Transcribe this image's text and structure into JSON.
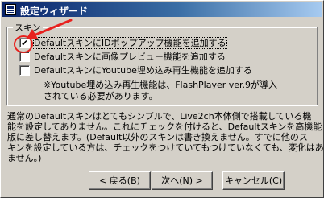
{
  "window": {
    "title": "設定ウィザード"
  },
  "skin_group": {
    "label": "スキン",
    "options": [
      {
        "label": "DefaultスキンにIDポップアップ機能を追加する",
        "checked": true
      },
      {
        "label": "Defaultスキンに画像プレビュー機能を追加する",
        "checked": false
      },
      {
        "label": "DefaultスキンにYoutube埋め込み再生機能を追加する",
        "checked": false
      }
    ],
    "note": "※Youtube埋め込み再生機能は、FlashPlayer ver.9が導入\nされている必要があります。"
  },
  "description": "通常のDefaultスキンはとてもシンプルで、Live2ch本体側で搭載している機\n能を設定してありません。これにチェックを付けると、Defaultスキンを高機能\n版に差し替えます。(Default以外のスキンは書き換えません。すでに他のス\nキンを設定している方は、チェックをつけていてもつけていなくても、変化はあり\nません。)",
  "buttons": {
    "back": "< 戻る(B)",
    "next": "次へ(N) >",
    "cancel": "キャンセル(C)"
  },
  "colors": {
    "title_bar": "#0a246a",
    "annotation": "#e8211e",
    "face": "#d4d0c8"
  }
}
